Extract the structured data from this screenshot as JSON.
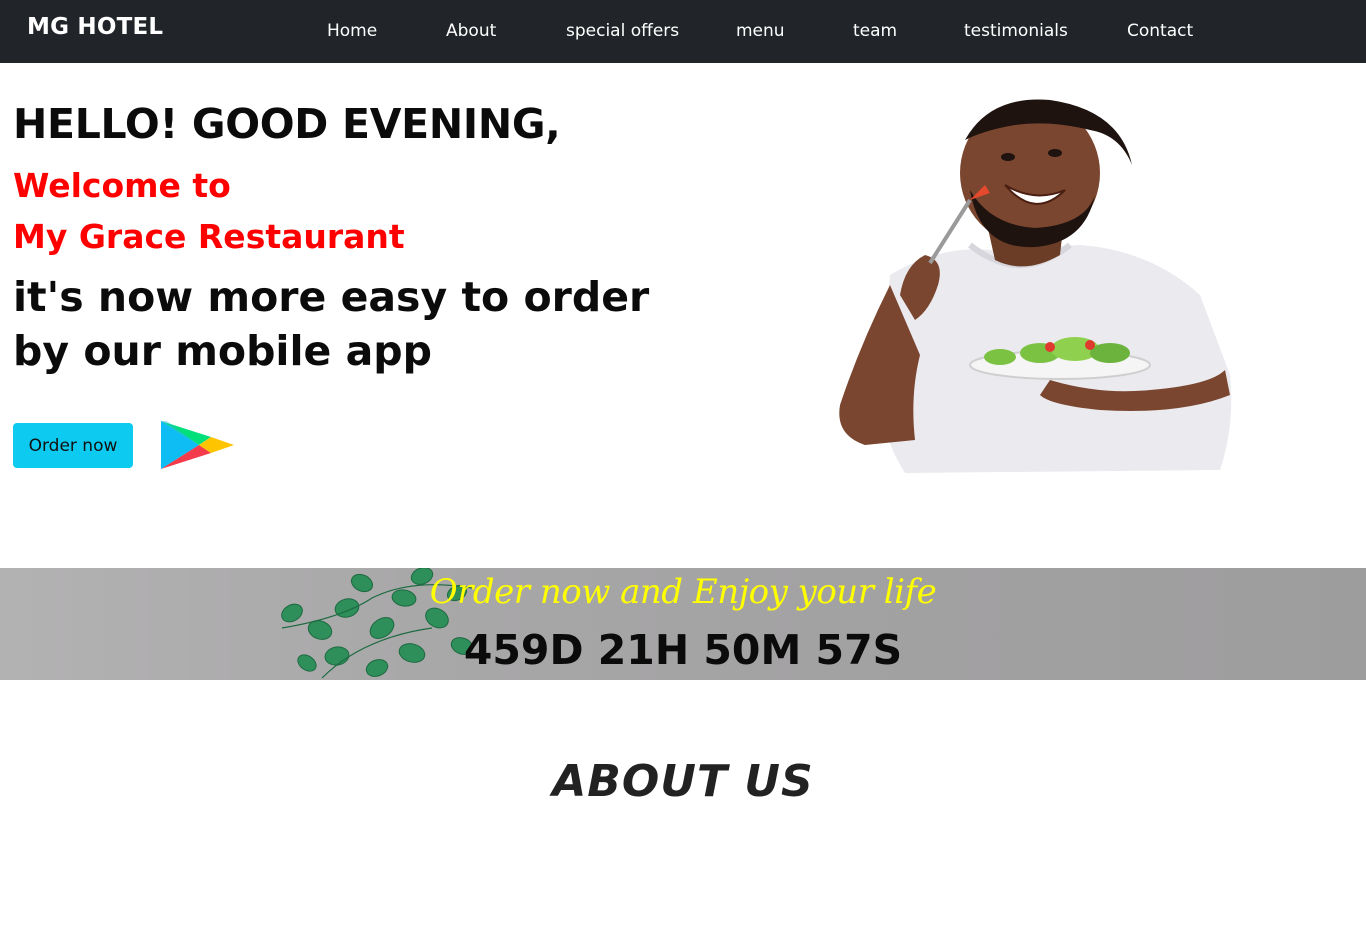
{
  "navbar": {
    "brand": "MG HOTEL",
    "links": [
      "Home",
      "About",
      "special offers",
      "menu",
      "team",
      "testimonials",
      "Contact"
    ]
  },
  "hero": {
    "greeting": "HELLO! GOOD EVENING,",
    "welcome_line1": "Welcome to",
    "welcome_line2": "My Grace Restaurant",
    "subtitle": "it's now more easy to order by our mobile app",
    "order_button": "Order now",
    "store_icon": "google-play-icon",
    "image_subject": "smiling-man-eating-salad"
  },
  "banner": {
    "tagline": "Order now and Enjoy your life",
    "countdown": "459D 21H 50M 57S"
  },
  "about": {
    "title": "ABOUT US"
  },
  "colors": {
    "navbar_bg": "#212529",
    "accent_red": "#ff0000",
    "button_bg": "#0dcaf0",
    "tagline_yellow": "#ffff00"
  }
}
